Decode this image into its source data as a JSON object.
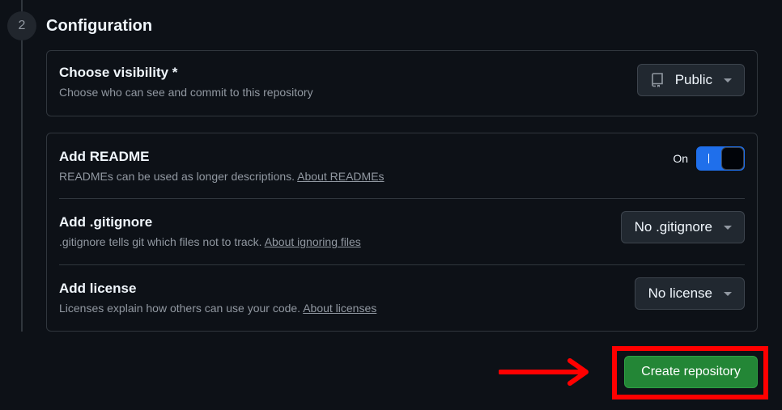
{
  "step": {
    "number": "2",
    "title": "Configuration"
  },
  "visibility": {
    "title": "Choose visibility *",
    "description": "Choose who can see and commit to this repository",
    "selected": "Public",
    "icon": "repo-icon"
  },
  "readme": {
    "title": "Add README",
    "description": "READMEs can be used as longer descriptions.",
    "link": "About READMEs",
    "toggle_state": "On"
  },
  "gitignore": {
    "title": "Add .gitignore",
    "description": ".gitignore tells git which files not to track.",
    "link": "About ignoring files",
    "selected": "No .gitignore"
  },
  "license": {
    "title": "Add license",
    "description": "Licenses explain how others can use your code.",
    "link": "About licenses",
    "selected": "No license"
  },
  "actions": {
    "create_label": "Create repository"
  },
  "colors": {
    "accent_blue": "#1f6feb",
    "create_green": "#238636",
    "annotation_red": "#ff0000"
  }
}
